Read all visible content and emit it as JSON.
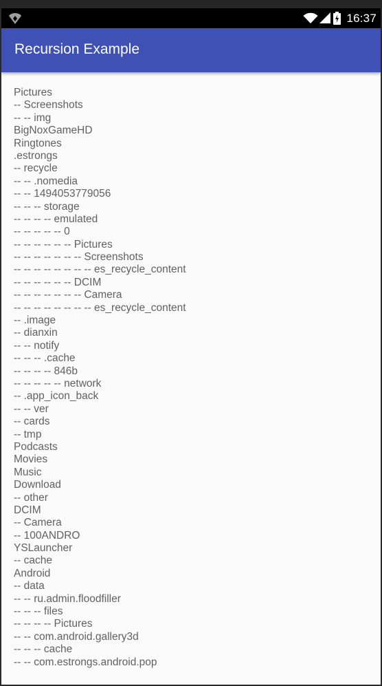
{
  "status_bar": {
    "time": "16:37",
    "left_icon": "notification-icon",
    "icons": [
      "wifi-icon",
      "signal-icon",
      "battery-icon"
    ]
  },
  "app_bar": {
    "title": "Recursion Example",
    "color": "#3f51b5"
  },
  "tree_lines": [
    "Pictures",
    "-- Screenshots",
    "-- -- img",
    "BigNoxGameHD",
    "Ringtones",
    ".estrongs",
    "-- recycle",
    "-- -- .nomedia",
    "-- -- 1494053779056",
    "-- -- -- storage",
    "-- -- -- -- emulated",
    "-- -- -- -- -- 0",
    "-- -- -- -- -- -- Pictures",
    "-- -- -- -- -- -- -- Screenshots",
    "-- -- -- -- -- -- -- -- es_recycle_content",
    "-- -- -- -- -- -- DCIM",
    "-- -- -- -- -- -- -- Camera",
    "-- -- -- -- -- -- -- -- es_recycle_content",
    "-- .image",
    "-- dianxin",
    "-- -- notify",
    "-- -- -- .cache",
    "-- -- -- -- 846b",
    "-- -- -- -- -- network",
    "-- .app_icon_back",
    "-- -- ver",
    "-- cards",
    "-- tmp",
    "Podcasts",
    "Movies",
    "Music",
    "Download",
    "-- other",
    "DCIM",
    "-- Camera",
    "-- 100ANDRO",
    "YSLauncher",
    "-- cache",
    "Android",
    "-- data",
    "-- -- ru.admin.floodfiller",
    "-- -- -- files",
    "-- -- -- -- Pictures",
    "-- -- com.android.gallery3d",
    "-- -- -- cache",
    "-- -- com.estrongs.android.pop"
  ]
}
